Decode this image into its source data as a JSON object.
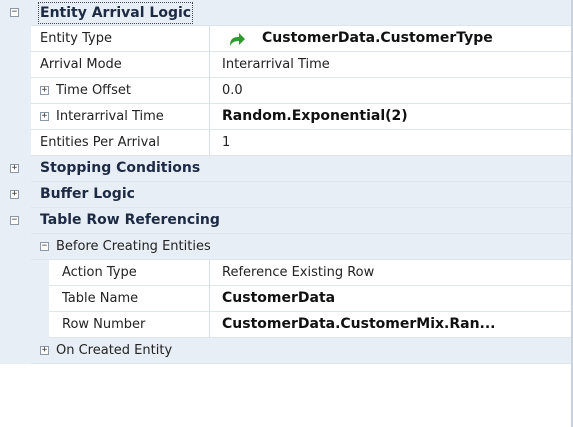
{
  "categories": {
    "entity_arrival": "Entity Arrival Logic",
    "stopping": "Stopping Conditions",
    "buffer": "Buffer Logic",
    "table_row": "Table Row Referencing"
  },
  "sub_categories": {
    "before_creating": "Before Creating Entities",
    "on_created": "On Created Entity"
  },
  "properties": {
    "entity_type": {
      "label": "Entity Type",
      "value": "CustomerData.CustomerType"
    },
    "arrival_mode": {
      "label": "Arrival Mode",
      "value": "Interarrival Time"
    },
    "time_offset": {
      "label": "Time Offset",
      "value": "0.0"
    },
    "interarrival_time": {
      "label": "Interarrival Time",
      "value": "Random.Exponential(2)"
    },
    "entities_per_arrival": {
      "label": "Entities Per Arrival",
      "value": "1"
    },
    "action_type": {
      "label": "Action Type",
      "value": "Reference Existing Row"
    },
    "table_name": {
      "label": "Table Name",
      "value": "CustomerData"
    },
    "row_number": {
      "label": "Row Number",
      "value": "CustomerData.CustomerMix.Ran..."
    }
  },
  "icons": {
    "entity_type_icon": "green-curved-arrow-icon"
  },
  "colors": {
    "category_background": "#e8eef5",
    "icon_green": "#2e9a2e"
  }
}
